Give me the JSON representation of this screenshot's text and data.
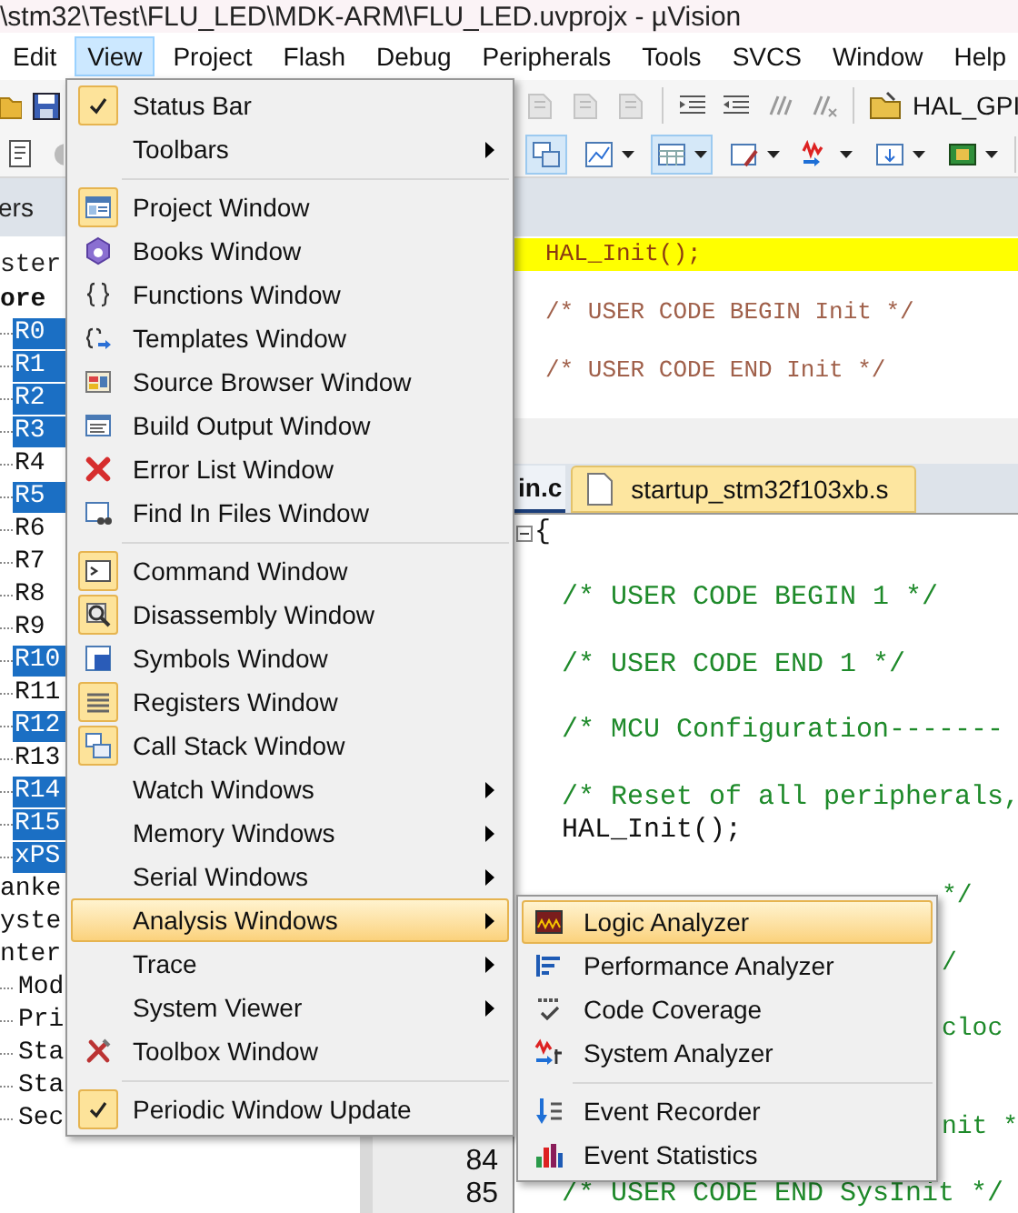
{
  "window": {
    "title": "\\stm32\\Test\\FLU_LED\\MDK-ARM\\FLU_LED.uvprojx - µVision"
  },
  "menu_bar": [
    {
      "label": "Edit",
      "selected": false
    },
    {
      "label": "View",
      "selected": true
    },
    {
      "label": "Project",
      "selected": false
    },
    {
      "label": "Flash",
      "selected": false
    },
    {
      "label": "Debug",
      "selected": false
    },
    {
      "label": "Peripherals",
      "selected": false
    },
    {
      "label": "Tools",
      "selected": false
    },
    {
      "label": "SVCS",
      "selected": false
    },
    {
      "label": "Window",
      "selected": false
    },
    {
      "label": "Help",
      "selected": false
    }
  ],
  "toolbar": {
    "find_field": "HAL_GPI"
  },
  "registers_panel": {
    "tab": "ers",
    "header": "ster",
    "tree": [
      {
        "label": "ore",
        "kind": "group",
        "children": [
          {
            "label": "R0",
            "selected": true
          },
          {
            "label": "R1",
            "selected": true
          },
          {
            "label": "R2",
            "selected": true
          },
          {
            "label": "R3",
            "selected": true
          },
          {
            "label": "R4",
            "selected": false
          },
          {
            "label": "R5",
            "selected": true
          },
          {
            "label": "R6",
            "selected": false
          },
          {
            "label": "R7",
            "selected": false
          },
          {
            "label": "R8",
            "selected": false
          },
          {
            "label": "R9",
            "selected": false
          },
          {
            "label": "R10",
            "selected": true
          },
          {
            "label": "R11",
            "selected": false
          },
          {
            "label": "R12",
            "selected": true
          },
          {
            "label": "R13",
            "selected": false
          },
          {
            "label": "R14",
            "selected": true
          },
          {
            "label": "R15",
            "selected": true
          },
          {
            "label": "xPS",
            "selected": true
          }
        ]
      },
      {
        "label": "anke",
        "kind": "item"
      },
      {
        "label": "yste",
        "kind": "item"
      },
      {
        "label": "nter",
        "kind": "item",
        "children": [
          {
            "label": "Mod",
            "selected": false
          },
          {
            "label": "Pri",
            "selected": false
          },
          {
            "label": "Sta",
            "selected": false
          },
          {
            "label": "Sta",
            "selected": false
          },
          {
            "label": "Sec",
            "selected": false
          }
        ]
      }
    ]
  },
  "disassembly": {
    "lines": [
      {
        "text": "HAL_Init();",
        "kind": "code",
        "selected": true
      },
      {
        "text": "/* USER CODE BEGIN Init */",
        "kind": "comment",
        "selected": false
      },
      {
        "text": "/* USER CODE END Init */",
        "kind": "comment",
        "selected": false
      }
    ]
  },
  "editor_tabs": [
    {
      "label": "in.c",
      "selected": true
    },
    {
      "label": "startup_stm32f103xb.s",
      "selected": false
    }
  ],
  "editor": {
    "lines": [
      {
        "kind": "fold",
        "text": "{"
      },
      {
        "kind": "blank"
      },
      {
        "kind": "comment",
        "text": "/* USER CODE BEGIN 1 */"
      },
      {
        "kind": "blank"
      },
      {
        "kind": "comment",
        "text": "/* USER CODE END 1 */"
      },
      {
        "kind": "blank"
      },
      {
        "kind": "comment",
        "text": "/* MCU Configuration-------"
      },
      {
        "kind": "blank"
      },
      {
        "kind": "comment",
        "text": "/* Reset of all peripherals,"
      },
      {
        "kind": "code",
        "text": "HAL_Init();"
      },
      {
        "kind": "blank"
      },
      {
        "kind": "tail",
        "text": "*/"
      },
      {
        "kind": "blank"
      },
      {
        "kind": "tail",
        "text": "/"
      },
      {
        "kind": "blank"
      },
      {
        "kind": "tail",
        "text": "cloc"
      },
      {
        "kind": "blank"
      },
      {
        "kind": "blank"
      },
      {
        "kind": "tail",
        "text": "nit *"
      },
      {
        "kind": "blank",
        "number": "84"
      },
      {
        "kind": "comment",
        "text": "/* USER CODE END SysInit */",
        "number": "85"
      }
    ]
  },
  "view_menu": {
    "items": [
      {
        "kind": "item",
        "label": "Status Bar",
        "checked": true,
        "submenu": false,
        "selected": false
      },
      {
        "kind": "item",
        "label": "Toolbars",
        "checked": false,
        "submenu": true,
        "selected": false
      },
      {
        "kind": "separator"
      },
      {
        "kind": "item",
        "label": "Project Window",
        "checked": true,
        "submenu": false,
        "selected": false
      },
      {
        "kind": "item",
        "label": "Books Window",
        "checked": false,
        "submenu": false,
        "selected": false
      },
      {
        "kind": "item",
        "label": "Functions Window",
        "checked": false,
        "submenu": false,
        "selected": false
      },
      {
        "kind": "item",
        "label": "Templates Window",
        "checked": false,
        "submenu": false,
        "selected": false
      },
      {
        "kind": "item",
        "label": "Source Browser Window",
        "checked": false,
        "submenu": false,
        "selected": false
      },
      {
        "kind": "item",
        "label": "Build Output Window",
        "checked": false,
        "submenu": false,
        "selected": false
      },
      {
        "kind": "item",
        "label": "Error List Window",
        "checked": false,
        "submenu": false,
        "selected": false
      },
      {
        "kind": "item",
        "label": "Find In Files Window",
        "checked": false,
        "submenu": false,
        "selected": false
      },
      {
        "kind": "separator"
      },
      {
        "kind": "item",
        "label": "Command Window",
        "checked": true,
        "submenu": false,
        "selected": false
      },
      {
        "kind": "item",
        "label": "Disassembly Window",
        "checked": true,
        "submenu": false,
        "selected": false
      },
      {
        "kind": "item",
        "label": "Symbols Window",
        "checked": false,
        "submenu": false,
        "selected": false
      },
      {
        "kind": "item",
        "label": "Registers Window",
        "checked": true,
        "submenu": false,
        "selected": false
      },
      {
        "kind": "item",
        "label": "Call Stack Window",
        "checked": true,
        "submenu": false,
        "selected": false
      },
      {
        "kind": "item",
        "label": "Watch Windows",
        "checked": false,
        "submenu": true,
        "selected": false
      },
      {
        "kind": "item",
        "label": "Memory Windows",
        "checked": false,
        "submenu": true,
        "selected": false
      },
      {
        "kind": "item",
        "label": "Serial Windows",
        "checked": false,
        "submenu": true,
        "selected": false
      },
      {
        "kind": "item",
        "label": "Analysis Windows",
        "checked": false,
        "submenu": true,
        "selected": true
      },
      {
        "kind": "item",
        "label": "Trace",
        "checked": false,
        "submenu": true,
        "selected": false
      },
      {
        "kind": "item",
        "label": "System Viewer",
        "checked": false,
        "submenu": true,
        "selected": false
      },
      {
        "kind": "item",
        "label": "Toolbox Window",
        "checked": false,
        "submenu": false,
        "selected": false
      },
      {
        "kind": "separator"
      },
      {
        "kind": "item",
        "label": "Periodic Window Update",
        "checked": true,
        "submenu": false,
        "selected": false
      }
    ]
  },
  "analysis_submenu": {
    "items": [
      {
        "kind": "item",
        "label": "Logic Analyzer",
        "selected": true
      },
      {
        "kind": "item",
        "label": "Performance Analyzer",
        "selected": false
      },
      {
        "kind": "item",
        "label": "Code Coverage",
        "selected": false
      },
      {
        "kind": "item",
        "label": "System Analyzer",
        "selected": false
      },
      {
        "kind": "separator"
      },
      {
        "kind": "item",
        "label": "Event Recorder",
        "selected": false
      },
      {
        "kind": "item",
        "label": "Event Statistics",
        "selected": false
      }
    ]
  }
}
